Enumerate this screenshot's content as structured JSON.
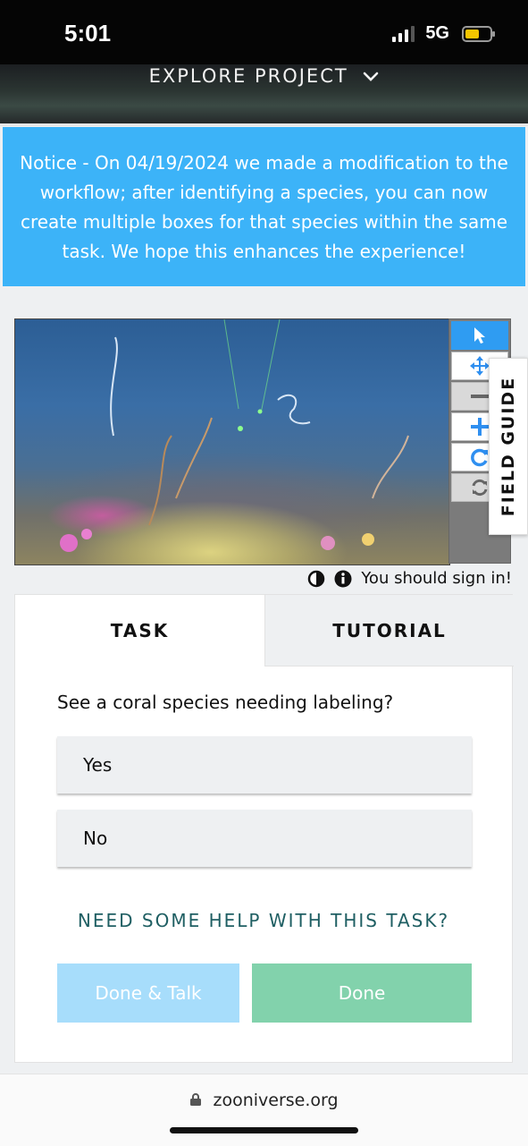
{
  "status": {
    "time": "5:01",
    "network": "5G"
  },
  "header": {
    "explore_label": "EXPLORE PROJECT"
  },
  "notice": {
    "text": "Notice - On 04/19/2024 we made a modification to the workflow; after identifying a species, you can now create multiple boxes for that species within the same task. We hope this enhances the experience!"
  },
  "viewer": {
    "tools": [
      "pointer-icon",
      "move-icon",
      "zoom-out-icon",
      "zoom-in-icon",
      "rotate-icon",
      "reset-icon"
    ],
    "field_guide_label": "FIELD GUIDE"
  },
  "signin": {
    "text": "You should sign in!"
  },
  "task": {
    "tabs": {
      "task": "TASK",
      "tutorial": "TUTORIAL"
    },
    "question": "See a coral species needing labeling?",
    "answers": [
      "Yes",
      "No"
    ],
    "help_link": "NEED SOME HELP WITH THIS TASK?",
    "done_talk": "Done & Talk",
    "done": "Done"
  },
  "browser": {
    "url": "zooniverse.org"
  },
  "colors": {
    "notice_bg": "#3cb3f8",
    "done_bg": "#82d2ac",
    "done_talk_bg": "#a7ddfb",
    "help_link": "#1f5f63",
    "tool_active": "#2f9cf2"
  }
}
